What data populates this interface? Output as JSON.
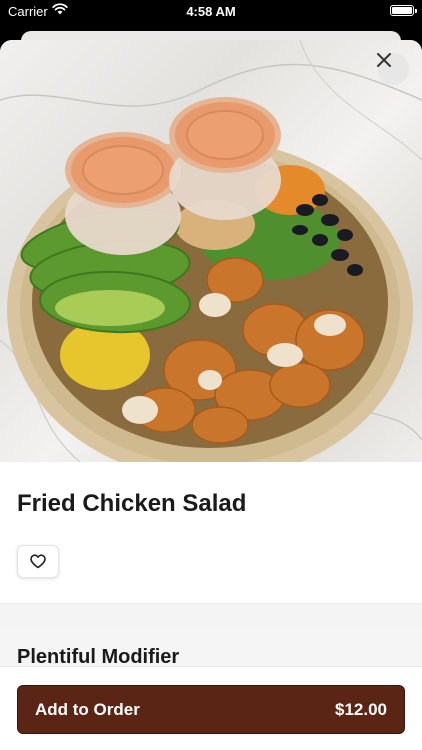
{
  "status_bar": {
    "carrier": "Carrier",
    "time": "4:58 AM"
  },
  "item": {
    "name": "Fried Chicken Salad"
  },
  "modifier": {
    "title": "Plentiful Modifier"
  },
  "order_button": {
    "label": "Add to Order",
    "price": "$12.00"
  },
  "colors": {
    "order_button": "#5b2515",
    "accent_brown": "#5b2515"
  },
  "icons": [
    "wifi-icon",
    "battery-icon",
    "close-icon",
    "heart-icon"
  ]
}
